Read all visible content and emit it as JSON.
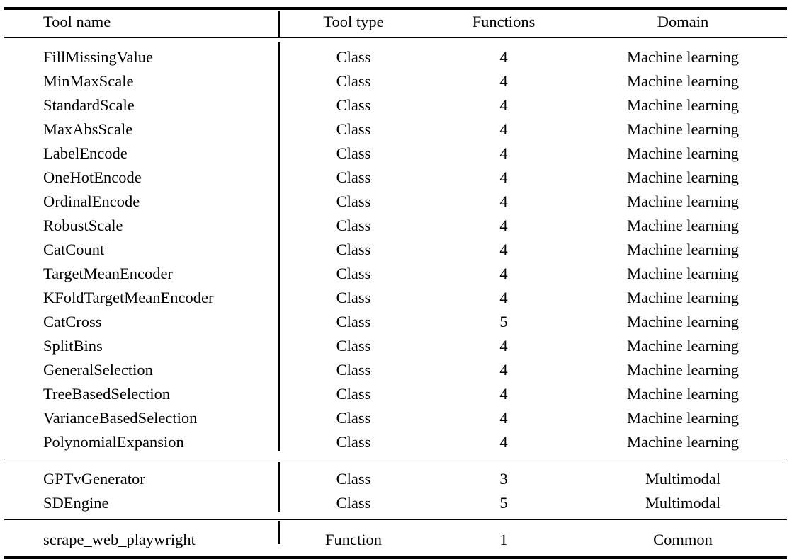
{
  "table": {
    "caption": "",
    "columns": [
      {
        "key": "tool_name",
        "label": "Tool name",
        "align": "left"
      },
      {
        "key": "tool_type",
        "label": "Tool type",
        "align": "center"
      },
      {
        "key": "functions",
        "label": "Functions",
        "align": "center"
      },
      {
        "key": "domain",
        "label": "Domain",
        "align": "center"
      }
    ],
    "blocks": [
      {
        "name": "machine-learning-block",
        "rows": [
          {
            "tool_name": "FillMissingValue",
            "tool_type": "Class",
            "functions": "4",
            "domain": "Machine learning"
          },
          {
            "tool_name": "MinMaxScale",
            "tool_type": "Class",
            "functions": "4",
            "domain": "Machine learning"
          },
          {
            "tool_name": "StandardScale",
            "tool_type": "Class",
            "functions": "4",
            "domain": "Machine learning"
          },
          {
            "tool_name": "MaxAbsScale",
            "tool_type": "Class",
            "functions": "4",
            "domain": "Machine learning"
          },
          {
            "tool_name": "LabelEncode",
            "tool_type": "Class",
            "functions": "4",
            "domain": "Machine learning"
          },
          {
            "tool_name": "OneHotEncode",
            "tool_type": "Class",
            "functions": "4",
            "domain": "Machine learning"
          },
          {
            "tool_name": "OrdinalEncode",
            "tool_type": "Class",
            "functions": "4",
            "domain": "Machine learning"
          },
          {
            "tool_name": "RobustScale",
            "tool_type": "Class",
            "functions": "4",
            "domain": "Machine learning"
          },
          {
            "tool_name": "CatCount",
            "tool_type": "Class",
            "functions": "4",
            "domain": "Machine learning"
          },
          {
            "tool_name": "TargetMeanEncoder",
            "tool_type": "Class",
            "functions": "4",
            "domain": "Machine learning"
          },
          {
            "tool_name": "KFoldTargetMeanEncoder",
            "tool_type": "Class",
            "functions": "4",
            "domain": "Machine learning"
          },
          {
            "tool_name": "CatCross",
            "tool_type": "Class",
            "functions": "5",
            "domain": "Machine learning"
          },
          {
            "tool_name": "SplitBins",
            "tool_type": "Class",
            "functions": "4",
            "domain": "Machine learning"
          },
          {
            "tool_name": "GeneralSelection",
            "tool_type": "Class",
            "functions": "4",
            "domain": "Machine learning"
          },
          {
            "tool_name": "TreeBasedSelection",
            "tool_type": "Class",
            "functions": "4",
            "domain": "Machine learning"
          },
          {
            "tool_name": "VarianceBasedSelection",
            "tool_type": "Class",
            "functions": "4",
            "domain": "Machine learning"
          },
          {
            "tool_name": "PolynomialExpansion",
            "tool_type": "Class",
            "functions": "4",
            "domain": "Machine learning"
          }
        ]
      },
      {
        "name": "multimodal-block",
        "rows": [
          {
            "tool_name": "GPTvGenerator",
            "tool_type": "Class",
            "functions": "3",
            "domain": "Multimodal"
          },
          {
            "tool_name": "SDEngine",
            "tool_type": "Class",
            "functions": "5",
            "domain": "Multimodal"
          }
        ]
      },
      {
        "name": "common-block",
        "rows": [
          {
            "tool_name": "scrape_web_playwright",
            "tool_type": "Function",
            "functions": "1",
            "domain": "Common"
          }
        ]
      }
    ]
  },
  "style": {
    "rule_color": "#000000",
    "text_color": "#000000",
    "background": "#ffffff"
  }
}
